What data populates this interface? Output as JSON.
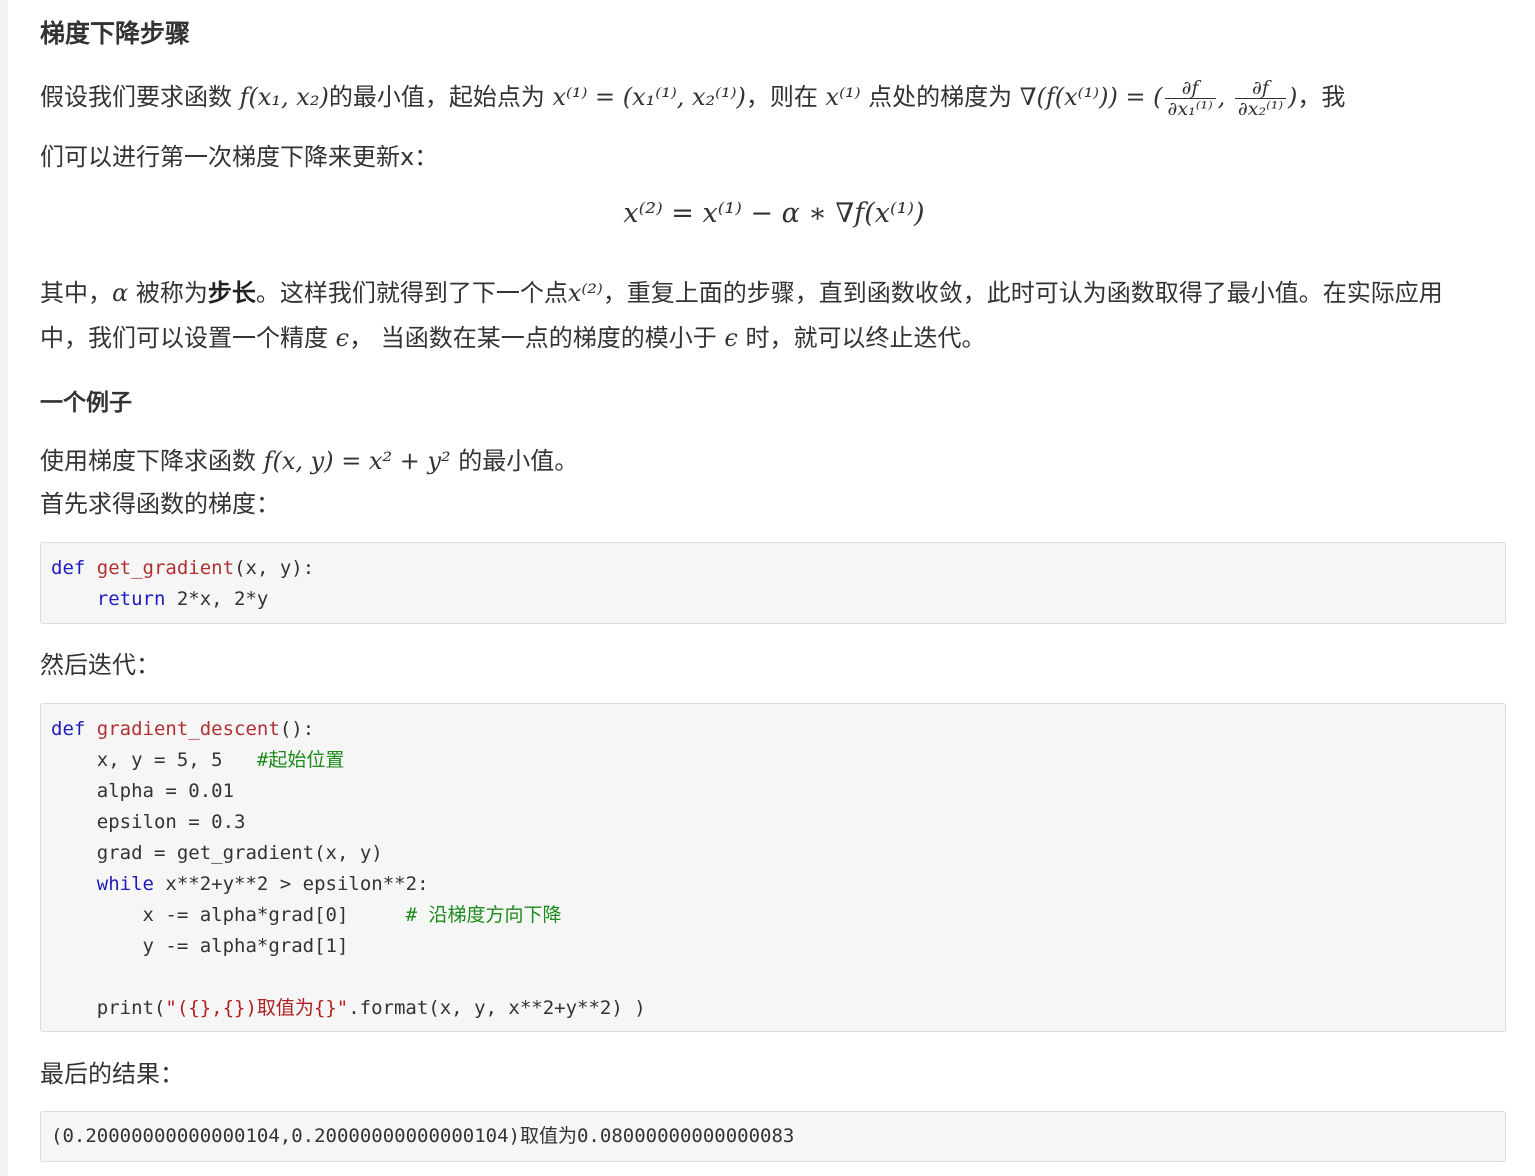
{
  "section1": {
    "heading": "梯度下降步骤",
    "p1_a": "假设我们要求函数 ",
    "p1_fx": "f(x₁, x₂)",
    "p1_b": "的最小值，起始点为 ",
    "p1_x1": "x⁽¹⁾ = (x₁⁽¹⁾, x₂⁽¹⁾)",
    "p1_c": "，则在 ",
    "p1_x1b": "x⁽¹⁾",
    "p1_d": " 点处的梯度为 ",
    "p1_grad": "∇(f(x⁽¹⁾)) = (",
    "p1_num1": "∂f",
    "p1_den1": "∂x₁⁽¹⁾",
    "p1_comma": ", ",
    "p1_num2": "∂f",
    "p1_den2": "∂x₂⁽¹⁾",
    "p1_close": ")",
    "p1_e": "，我",
    "p2": "们可以进行第一次梯度下降来更新x：",
    "formula": "x⁽²⁾ = x⁽¹⁾ − α ∗ ∇f(x⁽¹⁾)",
    "p3_a": "其中，",
    "p3_alpha": "α",
    "p3_b": " 被称为",
    "p3_step": "步长",
    "p3_c": "。这样我们就得到了下一个点",
    "p3_x2": "x⁽²⁾",
    "p3_d": "，重复上面的步骤，直到函数收敛，此时可认为函数取得了最小值。在实际应用",
    "p4_a": "中，我们可以设置一个精度 ",
    "p4_eps": "ϵ",
    "p4_b": "， 当函数在某一点的梯度的模小于 ",
    "p4_eps2": "ϵ",
    "p4_c": " 时，就可以终止迭代。"
  },
  "section2": {
    "heading": "一个例子",
    "p1_a": "使用梯度下降求函数 ",
    "p1_f": "f(x, y) = x² + y²",
    "p1_b": " 的最小值。",
    "p2": "首先求得函数的梯度：",
    "p3": "然后迭代：",
    "p4": "最后的结果："
  },
  "code1": {
    "l1_kw": "def",
    "l1_fn": "get_gradient",
    "l1_rest": "(x, y):",
    "l2_indent": "    ",
    "l2_kw": "return",
    "l2_rest": " 2*x, 2*y"
  },
  "code2": {
    "l1_kw": "def",
    "l1_fn": "gradient_descent",
    "l1_rest": "():",
    "l2": "    x, y = 5, 5   ",
    "l2_cm": "#起始位置",
    "l3": "    alpha = 0.01",
    "l4": "    epsilon = 0.3",
    "l5": "    grad = get_gradient(x, y)",
    "l6_indent": "    ",
    "l6_kw": "while",
    "l6_rest": " x**2+y**2 > epsilon**2:",
    "l7": "        x -= alpha*grad[0]     ",
    "l7_cm": "# 沿梯度方向下降",
    "l8": "        y -= alpha*grad[1]",
    "l9": "",
    "l10_a": "    print(",
    "l10_str": "\"({},{})取值为{}\"",
    "l10_b": ".format(x, y, x**2+y**2) )"
  },
  "output": {
    "text": "(0.20000000000000104,0.20000000000000104)取值为0.08000000000000083"
  }
}
